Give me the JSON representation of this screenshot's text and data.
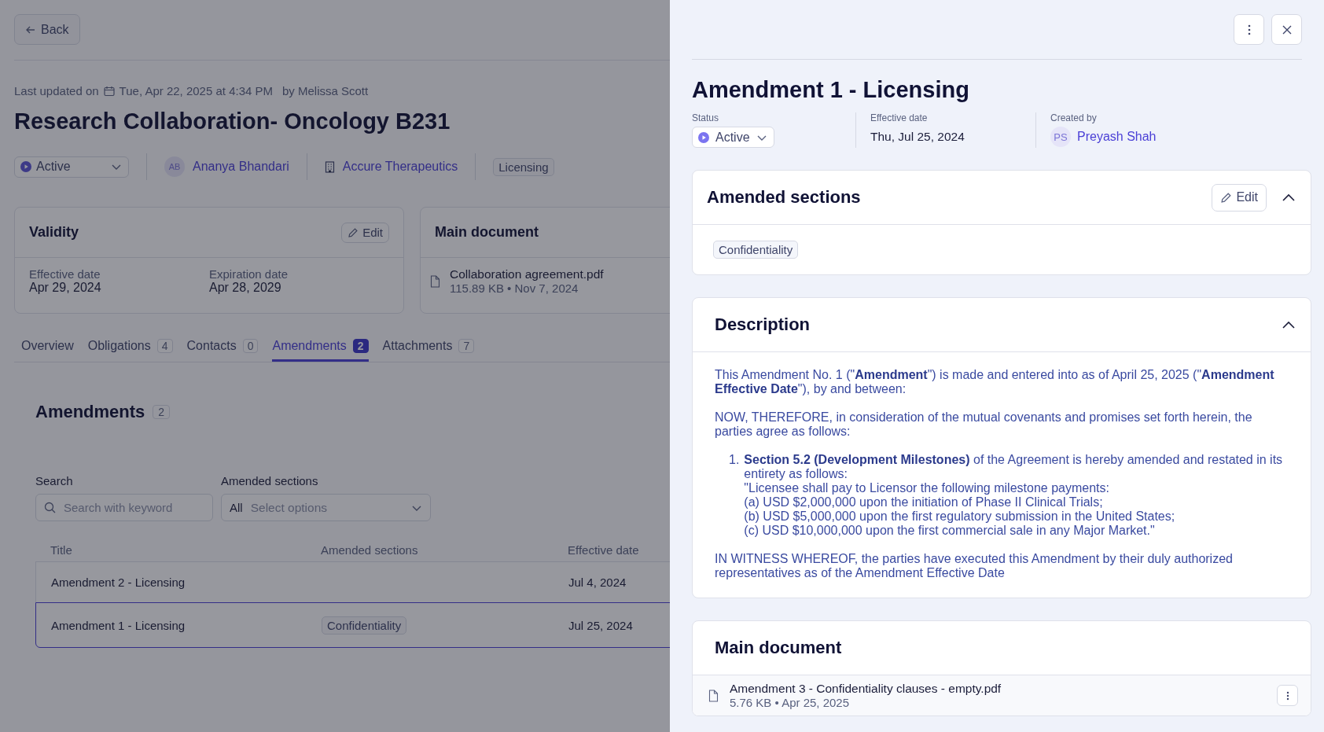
{
  "back_button": {
    "label": "Back"
  },
  "record": {
    "updated_label": "Last updated on",
    "updated_at": "Tue, Apr 22, 2025 at 4:34 PM",
    "updated_by": "by Melissa Scott",
    "title": "Research Collaboration- Oncology B231",
    "status": "Active",
    "owner": {
      "initials": "AB",
      "name": "Ananya Bhandari"
    },
    "company": "Accure Therapeutics",
    "type_tag": "Licensing"
  },
  "validity_card": {
    "title": "Validity",
    "edit_label": "Edit",
    "fields": [
      {
        "label": "Effective date",
        "value": "Apr 29, 2024"
      },
      {
        "label": "Expiration date",
        "value": "Apr 28, 2029"
      }
    ]
  },
  "main_document_card": {
    "title": "Main document",
    "file_name": "Collaboration agreement.pdf",
    "file_meta": "115.89 KB • Nov 7, 2024"
  },
  "tabs": [
    {
      "label": "Overview",
      "selected": false
    },
    {
      "label": "Obligations",
      "count": "4",
      "selected": false
    },
    {
      "label": "Contacts",
      "count": "0",
      "selected": false
    },
    {
      "label": "Amendments",
      "count": "2",
      "selected": true
    },
    {
      "label": "Attachments",
      "count": "7",
      "selected": false
    }
  ],
  "amendments": {
    "heading": "Amendments",
    "count": "2",
    "search": {
      "label": "Search",
      "placeholder": "Search with keyword"
    },
    "sections_filter": {
      "label": "Amended sections",
      "prefix": "All",
      "placeholder": "Select options"
    },
    "columns": [
      "Title",
      "Amended sections",
      "Effective date"
    ],
    "rows": [
      {
        "title": "Amendment 2 - Licensing",
        "date": "Jul 4, 2024",
        "selected": false
      },
      {
        "title": "Amendment 1 - Licensing",
        "sections": [
          "Confidentiality"
        ],
        "date": "Jul 25, 2024",
        "selected": true
      }
    ]
  },
  "drawer": {
    "title": "Amendment 1 - Licensing",
    "status_label": "Status",
    "status": "Active",
    "effective_label": "Effective date",
    "effective_date": "Thu, Jul 25, 2024",
    "created_label": "Created by",
    "creator": {
      "initials": "PS",
      "name": "Preyash Shah"
    },
    "sections_card": {
      "title": "Amended sections",
      "edit_label": "Edit",
      "expanded": true,
      "tags": [
        "Confidentiality"
      ]
    },
    "description_card": {
      "title": "Description",
      "expanded": true,
      "blocks": [
        {
          "kind": "paragraph",
          "text": "This Amendment No. 1 (\"**Amendment**\") is made and entered into as of April 25, 2025 (\"**Amendment Effective Date**\"), by and between:"
        },
        {
          "kind": "paragraph",
          "text": "NOW, THEREFORE, in consideration of the mutual covenants and promises set forth herein, the parties agree as follows:"
        },
        {
          "kind": "list_item",
          "number": "1.",
          "lines": [
            "**Section 5.2 (Development Milestones)** of the Agreement is hereby amended and restated in its entirety as follows:",
            "\"Licensee shall pay to Licensor the following milestone payments:",
            "(a) USD $2,000,000 upon the initiation of Phase II Clinical Trials;",
            "(b) USD $5,000,000 upon the first regulatory submission in the United States;",
            "(c) USD $10,000,000 upon the first commercial sale in any Major Market.\""
          ]
        },
        {
          "kind": "paragraph",
          "text": "IN WITNESS WHEREOF, the parties have executed this Amendment by their duly authorized representatives as of the Amendment Effective Date"
        }
      ]
    },
    "document_card": {
      "title": "Main document",
      "file_name": "Amendment 3 - Confidentiality clauses - empty.pdf",
      "file_meta": "5.76 KB • Apr 25, 2025"
    }
  }
}
